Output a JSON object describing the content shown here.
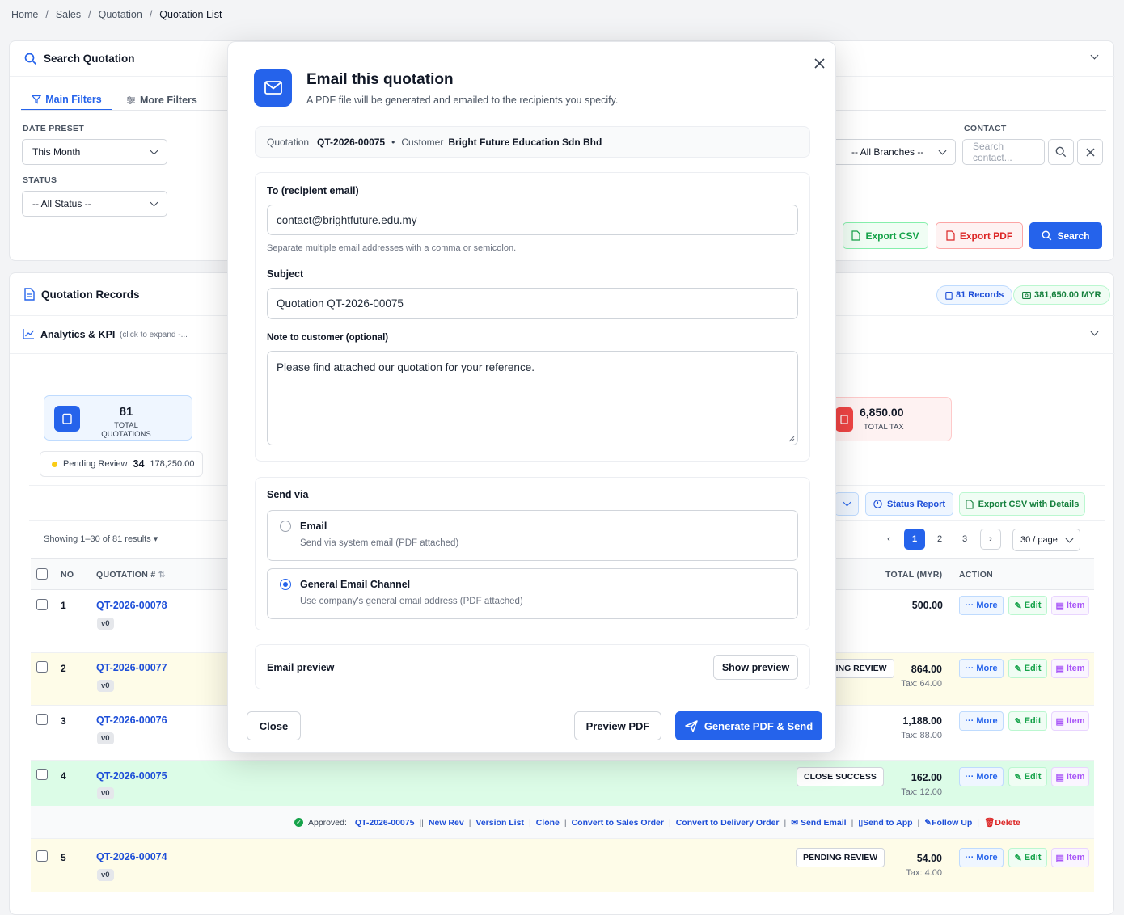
{
  "breadcrumb": [
    "Home",
    "Sales",
    "Quotation",
    "Quotation List"
  ],
  "search_panel": {
    "title": "Search Quotation",
    "tabs": [
      "Main Filters",
      "More Filters"
    ],
    "date_preset_label": "DATE PRESET",
    "date_preset_value": "This Month",
    "status_label": "STATUS",
    "status_value": "-- All Status --",
    "branch_value": "-- All Branches --",
    "contact_label": "CONTACT",
    "contact_placeholder": "Search contact...",
    "export_csv": "Export CSV",
    "export_pdf": "Export PDF",
    "search": "Search"
  },
  "records": {
    "title": "Quotation Records",
    "count_badge": "81 Records",
    "total_badge": "381,650.00 MYR",
    "analytics_title": "Analytics & KPI",
    "analytics_hint": "(click to expand -...",
    "kpi_total_value": "81",
    "kpi_total_label": "TOTAL QUOTATIONS",
    "kpi_tax_value": "6,850.00",
    "kpi_tax_label": "TOTAL TAX",
    "pending_label": "Pending Review",
    "pending_count": "34",
    "pending_amount": "178,250.00",
    "status_report": "Status Report",
    "export_csv_details": "Export CSV with Details",
    "showing": "Showing 1–30 of 81 results",
    "pages": [
      "1",
      "2",
      "3"
    ],
    "per_page": "30 / page",
    "col_no": "NO",
    "col_quotation": "QUOTATION #",
    "col_total": "TOTAL (MYR)",
    "col_action": "ACTION",
    "action_more": "More",
    "action_edit": "Edit",
    "action_item": "Item",
    "rows": [
      {
        "no": "1",
        "id": "QT-2026-00078",
        "ver": "v0",
        "status": "",
        "total": "500.00",
        "tax": ""
      },
      {
        "no": "2",
        "id": "QT-2026-00077",
        "ver": "v0",
        "status": "DING REVIEW",
        "total": "864.00",
        "tax": "Tax: 64.00"
      },
      {
        "no": "3",
        "id": "QT-2026-00076",
        "ver": "v0",
        "status": "",
        "total": "1,188.00",
        "tax": "Tax: 88.00"
      },
      {
        "no": "4",
        "id": "QT-2026-00075",
        "ver": "v0",
        "status": "CLOSE SUCCESS",
        "total": "162.00",
        "tax": "Tax: 12.00"
      },
      {
        "no": "5",
        "id": "QT-2026-00074",
        "ver": "v0",
        "status": "PENDING REVIEW",
        "total": "54.00",
        "tax": "Tax: 4.00"
      }
    ],
    "detail_bar": {
      "approved": "Approved:",
      "id": "QT-2026-00075",
      "links": [
        "New Rev",
        "Version List",
        "Clone",
        "Convert to Sales Order",
        "Convert to Delivery Order",
        "Send Email",
        "Send to App",
        "Follow Up",
        "Delete"
      ]
    }
  },
  "modal": {
    "title": "Email this quotation",
    "subtitle": "A PDF file will be generated and emailed to the recipients you specify.",
    "quotation_label": "Quotation",
    "quotation_id": "QT-2026-00075",
    "customer_label": "Customer",
    "customer_name": "Bright Future Education Sdn Bhd",
    "to_label": "To (recipient email)",
    "to_value": "contact@brightfuture.edu.my",
    "to_hint": "Separate multiple email addresses with a comma or semicolon.",
    "subject_label": "Subject",
    "subject_value": "Quotation QT-2026-00075",
    "note_label": "Note to customer (optional)",
    "note_value": "Please find attached our quotation for your reference.",
    "send_via_label": "Send via",
    "option_email_title": "Email",
    "option_email_desc": "Send via system email (PDF attached)",
    "option_general_title": "General Email Channel",
    "option_general_desc": "Use company's general email address (PDF attached)",
    "selected_option": "General Email Channel",
    "preview_label": "Email preview",
    "show_preview": "Show preview",
    "close": "Close",
    "preview_pdf": "Preview PDF",
    "generate_send": "Generate PDF & Send"
  },
  "colors": {
    "primary": "#2563eb",
    "row_pending_bg": "#fefce8",
    "row_success_bg": "#dcfce7",
    "export_csv": "#16a34a",
    "export_pdf": "#dc2626"
  }
}
